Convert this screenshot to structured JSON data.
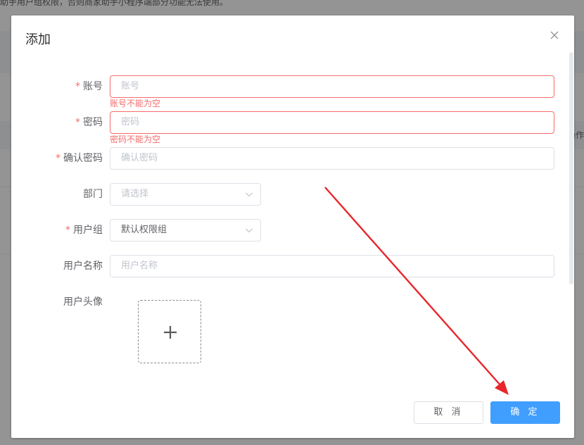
{
  "background": {
    "notice": "助手用户组权限，否则商家助手小程序端部分功能无法使用。",
    "side_text": "操作"
  },
  "dialog": {
    "title": "添加",
    "close_icon": "close-icon"
  },
  "form": {
    "account": {
      "label": "账号",
      "placeholder": "账号",
      "error": "账号不能为空",
      "required": true
    },
    "password": {
      "label": "密码",
      "placeholder": "密码",
      "error": "密码不能为空",
      "required": true
    },
    "confirm_password": {
      "label": "确认密码",
      "placeholder": "确认密码",
      "required": true
    },
    "department": {
      "label": "部门",
      "placeholder": "请选择"
    },
    "user_group": {
      "label": "用户组",
      "value": "默认权限组",
      "required": true
    },
    "user_name": {
      "label": "用户名称",
      "placeholder": "用户名称"
    },
    "avatar": {
      "label": "用户头像",
      "upload_icon": "plus-icon"
    }
  },
  "footer": {
    "cancel_label": "取 消",
    "ok_label": "确 定"
  },
  "colors": {
    "primary": "#409eff",
    "danger": "#f56c6c",
    "annotation_arrow": "#e8262b"
  }
}
